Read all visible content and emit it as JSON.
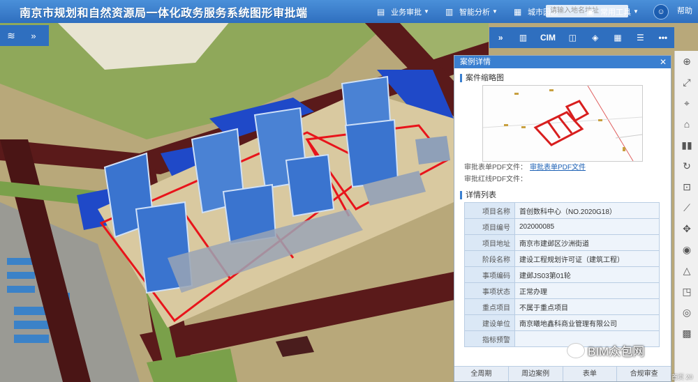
{
  "header": {
    "title": "南京市规划和自然资源局一体化政务服务系统图形审批端",
    "menus": [
      {
        "label": "业务审批",
        "icon": "briefcase-icon"
      },
      {
        "label": "智能分析",
        "icon": "chart-icon"
      },
      {
        "label": "城市园区",
        "icon": "building-icon"
      },
      {
        "label": "常用工具",
        "icon": "toolbox-icon"
      }
    ],
    "search_placeholder": "请输入地名地址",
    "help_label": "帮助"
  },
  "toolbar": {
    "items": [
      {
        "label": "",
        "icon": "expand-icon"
      },
      {
        "label": "",
        "icon": "book-icon"
      },
      {
        "label": "CIM",
        "icon": ""
      },
      {
        "label": "",
        "icon": "report-icon"
      },
      {
        "label": "",
        "icon": "layers-icon"
      },
      {
        "label": "",
        "icon": "building-icon"
      },
      {
        "label": "",
        "icon": "list-icon"
      },
      {
        "label": "•••",
        "icon": "more-icon"
      }
    ]
  },
  "panel": {
    "title": "案例详情",
    "thumb_section": "案件缩略图",
    "pdf_rows": [
      {
        "label": "审批表单PDF文件：",
        "link": "审批表单PDF文件"
      },
      {
        "label": "审批红线PDF文件：",
        "link": ""
      }
    ],
    "detail_section": "详情列表",
    "rows": [
      {
        "key": "项目名称",
        "value": "首创数科中心（NO.2020G18）"
      },
      {
        "key": "项目编号",
        "value": "202000085"
      },
      {
        "key": "项目地址",
        "value": "南京市建邺区沙洲街道"
      },
      {
        "key": "阶段名称",
        "value": "建设工程规划许可证（建筑工程）"
      },
      {
        "key": "事项编码",
        "value": "建邺JS03第01轮"
      },
      {
        "key": "事项状态",
        "value": "正常办理"
      },
      {
        "key": "重点项目",
        "value": "不属于重点项目"
      },
      {
        "key": "建设单位",
        "value": "南京曦地鑫科商业管理有限公司"
      },
      {
        "key": "指标预警",
        "value": ""
      }
    ],
    "tabs": [
      "全周期",
      "周边案例",
      "表单",
      "合规审查"
    ]
  },
  "watermark": "BIM众包网",
  "corner_text": "首页 20",
  "colors": {
    "header": "#2f6fbf",
    "panel_header": "#3a7fd0",
    "redline": "#e8141b"
  }
}
